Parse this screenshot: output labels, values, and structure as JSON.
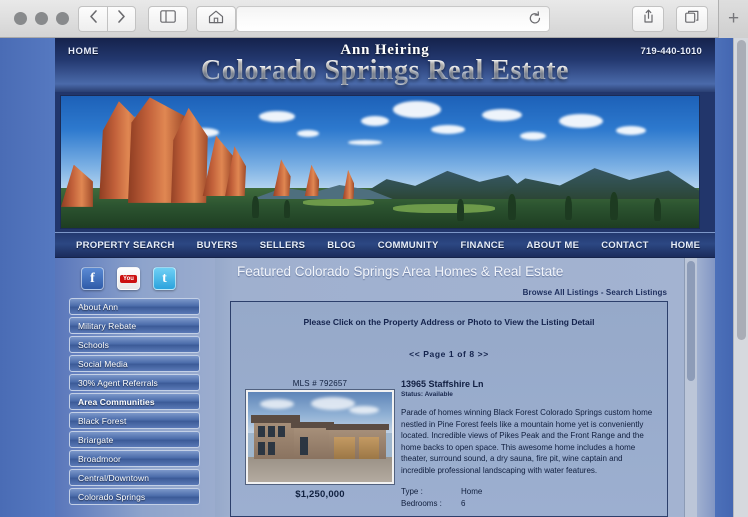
{
  "browser": {
    "traffic_lights": [
      "close",
      "minimize",
      "zoom"
    ],
    "back_icon": "chevron-left-icon",
    "forward_icon": "chevron-right-icon",
    "sidebar_icon": "sidebar-icon",
    "home_icon": "home-icon",
    "share_icon": "share-icon",
    "tabs_icon": "tab-overview-icon",
    "reload_icon": "reload-icon",
    "new_tab_label": "+",
    "url_value": "",
    "url_placeholder": ""
  },
  "site": {
    "header": {
      "home_link": "HOME",
      "agent_name": "Ann Heiring",
      "site_title": "Colorado Springs Real Estate",
      "phone": "719-440-1010"
    },
    "nav": [
      "PROPERTY SEARCH",
      "BUYERS",
      "SELLERS",
      "BLOG",
      "COMMUNITY",
      "FINANCE",
      "ABOUT ME",
      "CONTACT",
      "HOME"
    ],
    "sidebar": {
      "socials": [
        {
          "name": "facebook",
          "glyph": "f"
        },
        {
          "name": "youtube",
          "glyph": "You"
        },
        {
          "name": "twitter",
          "glyph": "t"
        }
      ],
      "items": [
        {
          "label": "About Ann",
          "bold": false
        },
        {
          "label": "Military Rebate",
          "bold": false
        },
        {
          "label": "Schools",
          "bold": false
        },
        {
          "label": "Social Media",
          "bold": false
        },
        {
          "label": "30% Agent Referrals",
          "bold": false
        },
        {
          "label": "Area Communities",
          "bold": true
        },
        {
          "label": "Black Forest",
          "bold": false
        },
        {
          "label": "Briargate",
          "bold": false
        },
        {
          "label": "Broadmoor",
          "bold": false
        },
        {
          "label": "Central/Downtown",
          "bold": false
        },
        {
          "label": "Colorado Springs",
          "bold": false
        }
      ]
    },
    "main": {
      "title": "Featured Colorado Springs Area Homes & Real Estate",
      "browse_links": "Browse All Listings - Search Listings",
      "click_note": "Please Click on the Property Address or Photo to View the Listing Detail",
      "pager": "<<  Page 1 of 8  >>",
      "listing": {
        "mls": "MLS # 792657",
        "price": "$1,250,000",
        "address": "13965 Staffshire Ln",
        "status": "Status: Available",
        "description": "Parade of homes winning Black Forest Colorado Springs custom home nestled in Pine Forest feels like a mountain home yet is conveniently located. Incredible views of Pikes Peak and the Front Range and the home backs to open space. This awesome home includes a home theater, surround sound, a dry sauna, fire pit, wine captain and incredible professional landscaping with water features.",
        "specs": [
          {
            "key": "Type :",
            "value": "Home"
          },
          {
            "key": "Bedrooms :",
            "value": "6"
          }
        ]
      }
    },
    "colors": {
      "header_dark": "#15224c",
      "nav_blue": "#2c4783",
      "page_bg": "#4a6cb5",
      "content_bg": "#9fb0cf",
      "listing_border": "#2c3f6b",
      "text_dark": "#10203f"
    }
  }
}
